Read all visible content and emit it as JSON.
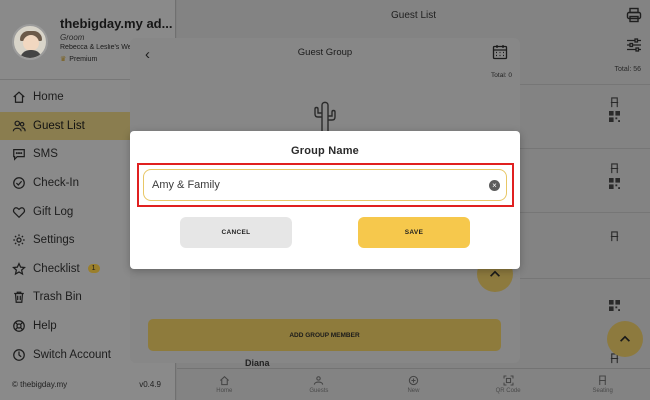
{
  "profile": {
    "name": "thebigday.my ad...",
    "role": "Groom",
    "event": "Rebecca & Leslie's Wed...",
    "plan": "Premium"
  },
  "sidebar": {
    "items": [
      {
        "label": "Home",
        "icon": "home-icon"
      },
      {
        "label": "Guest List",
        "icon": "guests-icon",
        "active": true
      },
      {
        "label": "SMS",
        "icon": "sms-icon"
      },
      {
        "label": "Check-In",
        "icon": "check-in-icon"
      },
      {
        "label": "Gift Log",
        "icon": "heart-icon"
      },
      {
        "label": "Settings",
        "icon": "gear-icon"
      },
      {
        "label": "Checklist",
        "icon": "star-icon",
        "badge": "1"
      },
      {
        "label": "Trash Bin",
        "icon": "trash-icon"
      },
      {
        "label": "Help",
        "icon": "help-icon"
      },
      {
        "label": "Switch Account",
        "icon": "switch-icon"
      }
    ],
    "copyright": "© thebigday.my",
    "version": "v0.4.9"
  },
  "main": {
    "title": "Guest List",
    "total": "Total: 56",
    "partial_row_name": "Diana",
    "tabs": [
      {
        "label": "Home",
        "icon": "home-icon"
      },
      {
        "label": "Guests",
        "icon": "guests-icon"
      },
      {
        "label": "New",
        "icon": "plus-circle-icon"
      },
      {
        "label": "QR Code",
        "icon": "qr-code-icon"
      },
      {
        "label": "Seating",
        "icon": "chair-icon"
      }
    ]
  },
  "group_panel": {
    "title": "Guest Group",
    "total": "Total: 0",
    "add_member_label": "ADD GROUP MEMBER"
  },
  "dialog": {
    "title": "Group Name",
    "input_value": "Amy & Family",
    "cancel_label": "CANCEL",
    "save_label": "SAVE"
  },
  "colors": {
    "accent": "#f6c84c",
    "highlight": "#e02020",
    "cancel_bg": "#e6e6e6"
  }
}
